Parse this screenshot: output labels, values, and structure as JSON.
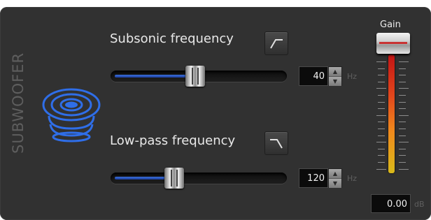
{
  "panel": {
    "title": "SUBWOOFER",
    "icon": "subwoofer-speaker-icon",
    "accent_color": "#2f6ee8"
  },
  "subsonic": {
    "label": "Subsonic frequency",
    "filter_icon": "high-pass-filter-icon",
    "value": "40",
    "unit": "Hz",
    "slider_position": 0.48
  },
  "lowpass": {
    "label": "Low-pass frequency",
    "filter_icon": "low-pass-filter-icon",
    "value": "120",
    "unit": "Hz",
    "slider_position": 0.36
  },
  "gain": {
    "label": "Gain",
    "value": "0.00",
    "unit": "dB"
  }
}
